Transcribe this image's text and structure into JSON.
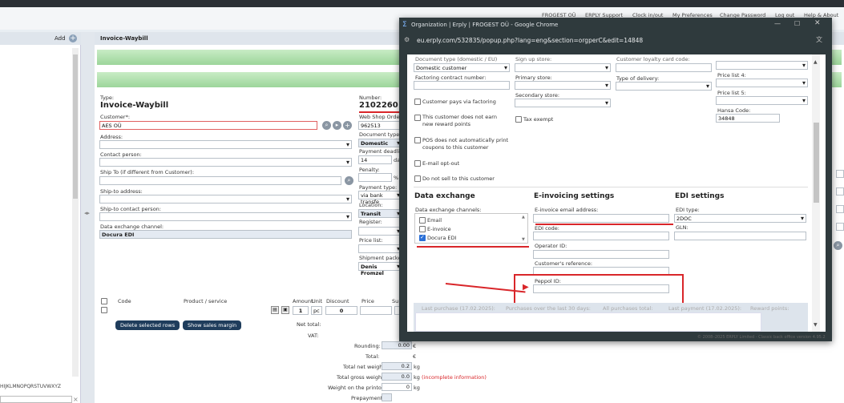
{
  "topbar": {
    "links": [
      "FROGEST OÜ",
      "ERPLY Support",
      "Clock in/out",
      "My Preferences",
      "Change Password",
      "Log out",
      "Help & About"
    ]
  },
  "left_panel": {
    "add_label": "Add",
    "alphabet": "HIJKLMNOPQRSTUVWXYZ"
  },
  "main": {
    "title": "Invoice-Waybill",
    "type_label": "Type:",
    "type_value": "Invoice-Waybill",
    "customer_label": "Customer*:",
    "customer_value": "AES OÜ",
    "address_label": "Address:",
    "contact_label": "Contact person:",
    "shipto_label": "Ship To (if different from Customer):",
    "shipto_address_label": "Ship-to address:",
    "shipto_contact_label": "Ship-to contact person:",
    "dx_channel_label": "Data exchange channel:",
    "dx_channel_value": "Docura EDI",
    "number_label": "Number:",
    "number_value": "2102260",
    "webshop_label": "Web Shop Order",
    "webshop_value": "962513",
    "doctype_label": "Document type (c",
    "doctype_value": "Domestic",
    "payment_deadline_label": "Payment deadlin",
    "payment_deadline_value": "14",
    "days_label": "da",
    "penalty_label": "Penalty:",
    "pct_label": "%",
    "payment_type_label": "Payment type:",
    "payment_type_value": "via bank transfe",
    "location_label": "Location:",
    "location_value": "Transit",
    "register_label": "Register:",
    "pricelist_label": "Price list:",
    "shipment_label": "Shipment packed",
    "shipment_value": "Denis Fromzel",
    "table_headers": {
      "code": "Code",
      "product": "Product / service",
      "amount": "Amount",
      "unit": "Unit",
      "discount": "Discount",
      "price": "Price",
      "sum": "Su"
    },
    "row": {
      "amount": "1",
      "unit": "pcs",
      "discount": "0"
    },
    "delete_btn": "Delete selected rows",
    "margin_btn": "Show sales margin",
    "net_total_label": "Net total:",
    "vat_label": "VAT:",
    "rounding_label": "Rounding:",
    "rounding_value": "0.00",
    "euro": "€",
    "total_label": "Total:",
    "total_value": "€",
    "net_weight_label": "Total net weight:",
    "net_weight_value": "0.2",
    "kg": "kg",
    "gross_weight_label": "Total gross weight:",
    "gross_weight_value": "0.0",
    "incomplete": "(incomplete information)",
    "printout_weight_label": "Weight on the printout:",
    "printout_weight_value": "0",
    "prepayment_label": "Prepayment:"
  },
  "popup": {
    "window_title": "Organization | Erply | FROGEST OÜ - Google Chrome",
    "url": "eu.erply.com/532835/popup.php?lang=eng&section=orgperC&edit=14848",
    "top_cut_labels": [
      "Document type (domestic / EU)",
      "Sign up store:",
      "Customer loyalty card code:"
    ],
    "customer_type_value": "Domestic customer",
    "factoring_label": "Factoring contract number:",
    "primary_store_label": "Primary store:",
    "delivery_type_label": "Type of delivery:",
    "secondary_store_label": "Secondary store:",
    "pricelist4_label": "Price list 4:",
    "pricelist5_label": "Price list 5:",
    "hansa_label": "Hansa Code:",
    "hansa_value": "34848",
    "cb_factoring": "Customer pays via factoring",
    "cb_noearn": "This customer does not earn new reward points",
    "cb_tax": "Tax exempt",
    "cb_pos": "POS does not automatically print coupons to this customer",
    "cb_optout": "E-mail opt-out",
    "cb_nosell": "Do not sell to this customer",
    "dx_title": "Data exchange",
    "dx_channels_label": "Data exchange channels:",
    "dx_channels": [
      "Email",
      "E-invoice",
      "Docura EDI"
    ],
    "einv_title": "E-invoicing settings",
    "einv_email_label": "E-invoice email address:",
    "edi_code_label": "EDI code:",
    "operator_label": "Operator ID:",
    "cust_ref_label": "Customer's reference:",
    "peppol_label": "Peppol ID:",
    "edi_title": "EDI settings",
    "edi_type_label": "EDI type:",
    "edi_type_value": "2DOC",
    "gln_label": "GLN:",
    "stats": [
      "Last purchase (17.02.2025):",
      "Purchases over the last 30 days:",
      "All purchases total:",
      "Last payment (17.02.2025):",
      "Reward points:"
    ],
    "footer": "© 2008–2025 ERPLY Limited - Classic back office version 4.95.2"
  },
  "colors": {
    "accent_red": "#d9262a",
    "green_bar": "#9cd59a",
    "navy_btn": "#1f3d5c"
  }
}
